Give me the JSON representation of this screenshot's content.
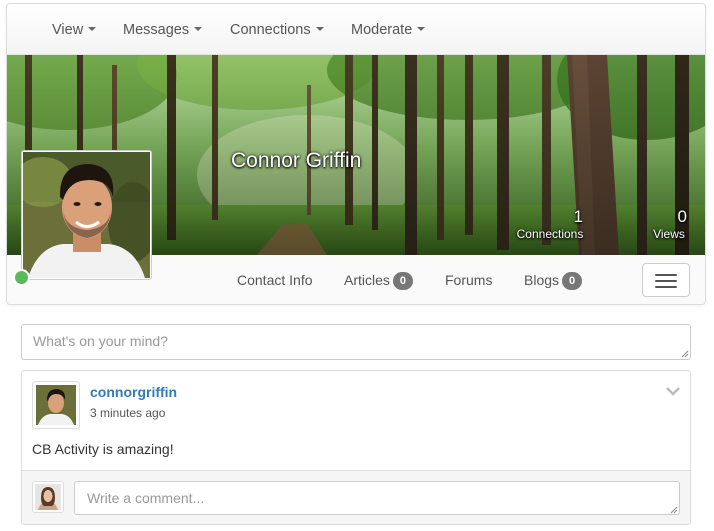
{
  "topnav": {
    "items": [
      {
        "label": "View"
      },
      {
        "label": "Messages"
      },
      {
        "label": "Connections"
      },
      {
        "label": "Moderate"
      }
    ]
  },
  "profile": {
    "name": "Connor Griffin",
    "online": true,
    "status_color": "#5cb85c",
    "stats": {
      "connections": {
        "value": "1",
        "label": "Connections"
      },
      "views": {
        "value": "0",
        "label": "Views"
      }
    }
  },
  "subnav": {
    "tabs": [
      {
        "label": "Contact Info"
      },
      {
        "label": "Articles",
        "badge": "0"
      },
      {
        "label": "Forums"
      },
      {
        "label": "Blogs",
        "badge": "0"
      }
    ],
    "menu_icon": "hamburger-icon"
  },
  "status": {
    "placeholder": "What's on your mind?"
  },
  "activity": {
    "username": "connorgriffin",
    "time": "3 minutes ago",
    "text": "CB Activity is amazing!",
    "comment_placeholder": "Write a comment..."
  },
  "colors": {
    "link": "#337ab7",
    "badge": "#777777"
  }
}
